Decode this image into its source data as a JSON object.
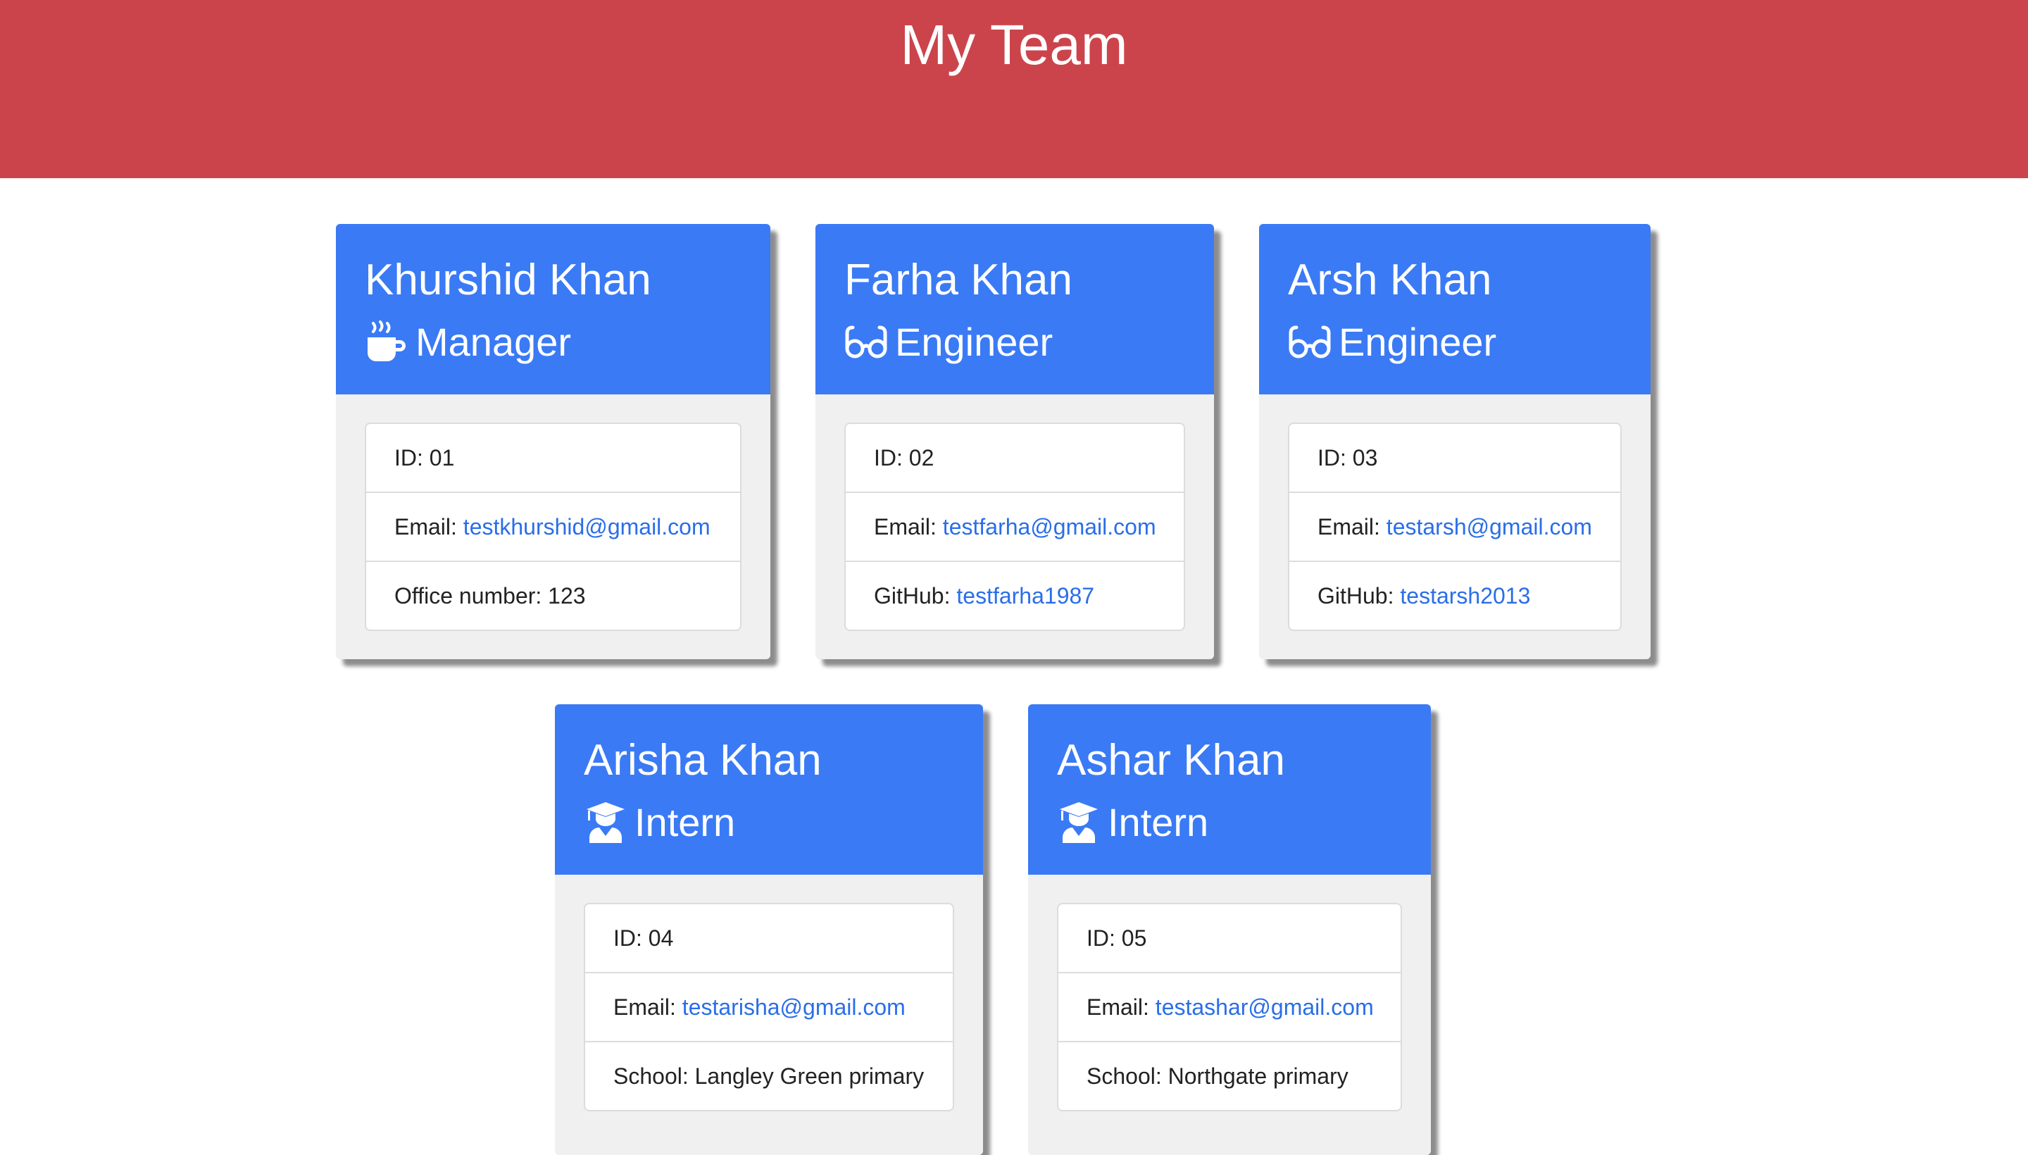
{
  "header": {
    "title": "My Team"
  },
  "colors": {
    "header_bg": "#cc444b",
    "card_header_bg": "#3a7af5",
    "link": "#2a6ee8"
  },
  "cards": [
    {
      "name": "Khurshid Khan",
      "role": "Manager",
      "role_icon": "coffee-icon",
      "id_label": "ID: 01",
      "email_label": "Email: ",
      "email": "testkhurshid@gmail.com",
      "extra_label": "Office number: 123",
      "extra_link": ""
    },
    {
      "name": "Farha Khan",
      "role": "Engineer",
      "role_icon": "glasses-icon",
      "id_label": "ID: 02",
      "email_label": "Email: ",
      "email": "testfarha@gmail.com",
      "extra_label": "GitHub: ",
      "extra_link": "testfarha1987"
    },
    {
      "name": "Arsh Khan",
      "role": "Engineer",
      "role_icon": "glasses-icon",
      "id_label": "ID: 03",
      "email_label": "Email: ",
      "email": "testarsh@gmail.com",
      "extra_label": "GitHub: ",
      "extra_link": "testarsh2013"
    },
    {
      "name": "Arisha Khan",
      "role": "Intern",
      "role_icon": "graduate-icon",
      "id_label": "ID: 04",
      "email_label": "Email: ",
      "email": "testarisha@gmail.com",
      "extra_label": "School: Langley Green primary",
      "extra_link": ""
    },
    {
      "name": "Ashar Khan",
      "role": "Intern",
      "role_icon": "graduate-icon",
      "id_label": "ID: 05",
      "email_label": "Email: ",
      "email": "testashar@gmail.com",
      "extra_label": "School: Northgate primary",
      "extra_link": ""
    }
  ]
}
